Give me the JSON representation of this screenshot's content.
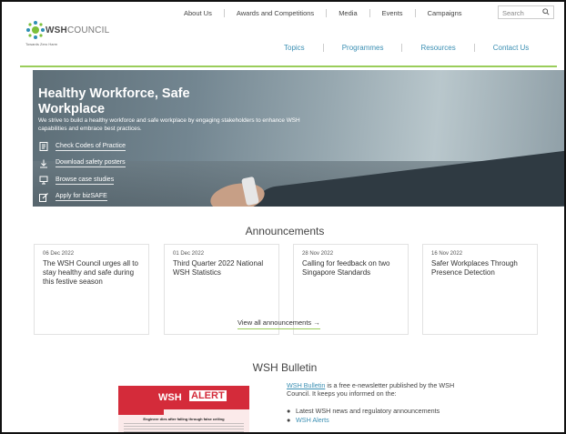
{
  "header": {
    "logo_bold": "WSH",
    "logo_light": "COUNCIL",
    "logo_tagline": "Towards Zero Harm",
    "top_links": [
      "About Us",
      "Awards and Competitions",
      "Media",
      "Events",
      "Campaigns"
    ],
    "search_placeholder": "Search",
    "main_nav": [
      "Topics",
      "Programmes",
      "Resources",
      "Contact Us"
    ]
  },
  "hero": {
    "title": "Healthy Workforce, Safe Workplace",
    "description": "We strive to build a healthy workforce and safe workplace by engaging stakeholders to enhance WSH capabilities and embrace best practices.",
    "links": [
      {
        "label": "Check Codes of Practice",
        "icon": "document-icon"
      },
      {
        "label": "Download safety posters",
        "icon": "download-icon"
      },
      {
        "label": "Browse case studies",
        "icon": "monitor-icon"
      },
      {
        "label": "Apply for bizSAFE",
        "icon": "edit-icon"
      }
    ]
  },
  "announcements": {
    "title": "Announcements",
    "items": [
      {
        "date": "06 Dec 2022",
        "title": "The WSH Council urges all to stay healthy and safe during this festive season"
      },
      {
        "date": "01 Dec 2022",
        "title": "Third Quarter 2022 National WSH Statistics"
      },
      {
        "date": "28 Nov 2022",
        "title": "Calling for feedback on two Singapore Standards"
      },
      {
        "date": "16 Nov 2022",
        "title": "Safer Workplaces Through Presence Detection"
      }
    ],
    "view_all": "View all announcements →"
  },
  "bulletin": {
    "title": "WSH Bulletin",
    "image_wsh": "WSH",
    "image_alert": "ALERT",
    "image_headline": "Engineer dies after falling through false ceiling",
    "link_text": "WSH Bulletin",
    "description": " is a free e-newsletter published by the WSH Council. It keeps you informed on the:",
    "bullets": [
      "Latest WSH news and regulatory announcements",
      "WSH Alerts"
    ]
  },
  "colors": {
    "accent_green": "#9acd5a",
    "link_blue": "#3b8fb3",
    "alert_red": "#d42b3a"
  }
}
